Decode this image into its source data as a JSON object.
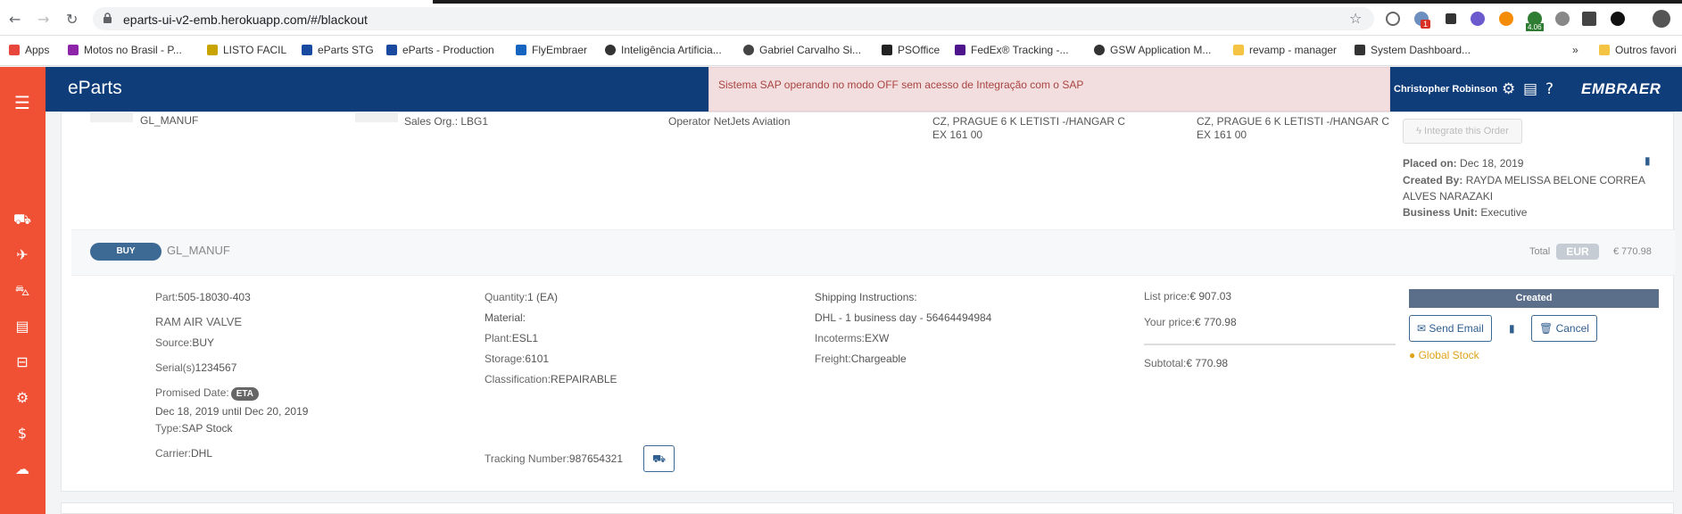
{
  "browser": {
    "url": "eparts-ui-v2-emb.herokuapp.com/#/blackout",
    "bookmarks": [
      "Apps",
      "Motos no Brasil - P...",
      "LISTO FACIL",
      "eParts STG",
      "eParts - Production",
      "FlyEmbraer",
      "Inteligência Artificia...",
      "Gabriel Carvalho Si...",
      "PSOffice",
      "FedEx® Tracking -...",
      "GSW Application M...",
      "revamp - manager",
      "System Dashboard...",
      "»",
      "Outros favori"
    ],
    "ext_badge_1": "1",
    "ext_badge_2": "4.06"
  },
  "app": {
    "brand": "eParts",
    "user": "Christopher Robinson",
    "logo": "EMBRAER",
    "alert": "Sistema SAP operando no modo OFF sem acesso de Integração com o SAP"
  },
  "order_header": {
    "customer": "GL_MANUF",
    "sales_org": "Sales Org.: LBG1",
    "operator": "Operator NetJets Aviation",
    "ship_to_1": "CZ, PRAGUE 6 K LETISTI -/HANGAR C",
    "ship_to_1b": "EX 161 00",
    "ship_to_2": "CZ, PRAGUE 6 K LETISTI -/HANGAR C",
    "ship_to_2b": "EX 161 00",
    "integrate_label": "Integrate this Order",
    "placed_label": "Placed on:",
    "placed_value": "Dec 18, 2019",
    "created_label": "Created By:",
    "created_value": "RAYDA MELISSA BELONE CORREA",
    "created_value_2": "ALVES NARAZAKI",
    "bu_label": "Business Unit:",
    "bu_value": "Executive"
  },
  "line": {
    "type_badge": "BUY",
    "customer": "GL_MANUF",
    "total_label": "Total",
    "currency": "EUR",
    "total_value": "€ 770.98",
    "part_label": "Part:",
    "part_value": "505-18030-403",
    "description": "RAM AIR VALVE",
    "source_label": "Source:",
    "source_value": "BUY",
    "serial_label": "Serial(s)",
    "serial_value": "1234567",
    "promised_label": "Promised Date:",
    "eta": "ETA",
    "promised_value": "Dec 18, 2019 until Dec 20, 2019",
    "type_label": "Type:",
    "type_value": "SAP Stock",
    "carrier_label": "Carrier:",
    "carrier_value": "DHL",
    "qty_label": "Quantity:",
    "qty_value": "1 (EA)",
    "material_label": "Material:",
    "plant_label": "Plant:",
    "plant_value": "ESL1",
    "storage_label": "Storage:",
    "storage_value": "6101",
    "class_label": "Classification:",
    "class_value": "REPAIRABLE",
    "tracking_label": "Tracking Number:",
    "tracking_value": "987654321",
    "ship_instr_label": "Shipping Instructions:",
    "ship_instr_value": "DHL - 1 business day - 56464494984",
    "incoterms_label": "Incoterms:",
    "incoterms_value": "EXW",
    "freight_label": "Freight:",
    "freight_value": "Chargeable",
    "list_price_label": "List price:",
    "list_price_value": "€ 907.03",
    "your_price_label": "Your price:",
    "your_price_value": "€ 770.98",
    "subtotal_label": "Subtotal:",
    "subtotal_value": "€ 770.98",
    "status": "Created",
    "send_email": "Send Email",
    "cancel": "Cancel",
    "global_stock": "Global Stock"
  }
}
